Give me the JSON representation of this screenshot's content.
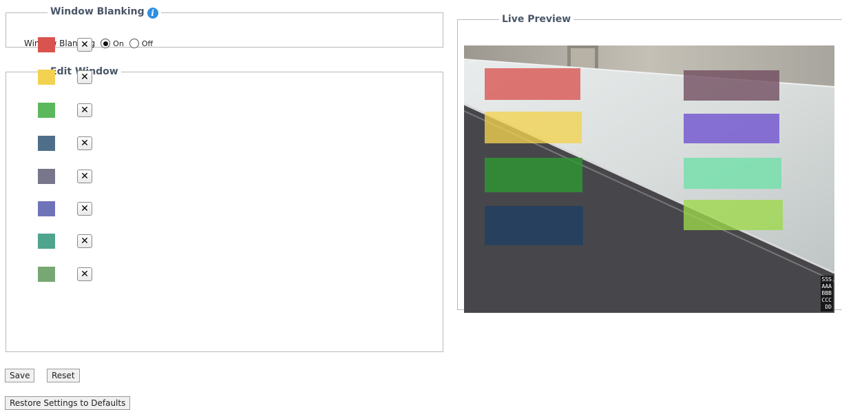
{
  "window_blanking_section": {
    "legend": "Window Blanking",
    "field_label": "Window Blanking",
    "options": [
      {
        "label": "On",
        "checked": true
      },
      {
        "label": "Off",
        "checked": false
      }
    ]
  },
  "edit_window_section": {
    "legend": "Edit Window",
    "delete_glyph": "✕",
    "windows": [
      {
        "color": "#d9534f"
      },
      {
        "color": "#f2d250"
      },
      {
        "color": "#5cb85c"
      },
      {
        "color": "#4f6e8a"
      },
      {
        "color": "#77768a"
      },
      {
        "color": "#6f74b8"
      },
      {
        "color": "#4fa48e"
      },
      {
        "color": "#77a772"
      }
    ]
  },
  "buttons": {
    "save": "Save",
    "reset": "Reset",
    "restore": "Restore Settings to Defaults"
  },
  "live_preview": {
    "legend": "Live Preview",
    "osd_lines": [
      "SSS",
      "AAA",
      "BBB",
      "CCC",
      "DD"
    ]
  }
}
